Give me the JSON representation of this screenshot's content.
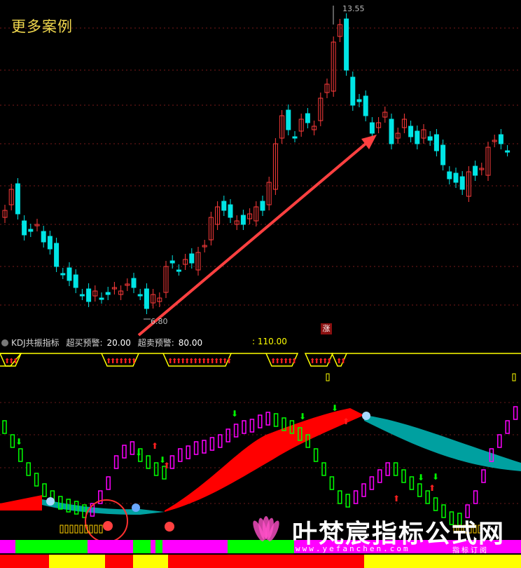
{
  "header": {
    "more_cases": "更多案例"
  },
  "price_chart": {
    "high_label": "13.55",
    "low_label": "6.80",
    "up_tag": "涨",
    "colors": {
      "up": "#ff3b3b",
      "down": "#00e5e5",
      "arrow": "#ff4040",
      "grid": "#7a1a1a"
    }
  },
  "indicator": {
    "name": "KDJ共振指标",
    "buy_label": "超买预警:",
    "buy_value": "20.00",
    "sell_label": "超卖预警:",
    "sell_value": "80.00",
    "threshold": ": 110.00",
    "colors": {
      "line_up": "#ff00ff",
      "line_down": "#00ff00",
      "band_bull": "#ff0000",
      "band_bear": "#00a0a0",
      "signal_line": "#ffff00"
    }
  },
  "watermark": {
    "title": "叶梵宸指标公式网",
    "url": "www.yefanchen.com",
    "subtitle": "指标订阅"
  },
  "chart_data": {
    "type": "candlestick",
    "title": "",
    "annotations": [
      "13.55",
      "6.80"
    ],
    "price_range": [
      6.5,
      14.0
    ],
    "points": [
      {
        "label": "max",
        "value": 13.55
      },
      {
        "label": "min",
        "value": 6.8
      }
    ]
  }
}
